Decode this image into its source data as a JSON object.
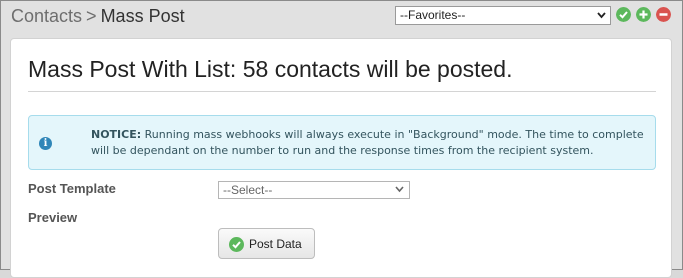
{
  "breadcrumb": {
    "parent": "Contacts",
    "separator": ">",
    "current": "Mass Post"
  },
  "favorites": {
    "selected": "--Favorites--",
    "actions": [
      "check-icon",
      "plus-icon",
      "minus-icon"
    ]
  },
  "main": {
    "title": "Mass Post With List: 58 contacts will be posted.",
    "notice": {
      "label": "NOTICE:",
      "text": " Running mass webhooks will always execute in \"Background\" mode. The time to complete will be dependant on the number to run and the response times from the recipient system.",
      "icon": "info-icon"
    },
    "post_template_label": "Post Template",
    "post_template_selected": "--Select--",
    "preview_label": "Preview",
    "post_button_label": "Post Data"
  },
  "colors": {
    "green": "#5cb85c",
    "red": "#d9534f",
    "info_blue": "#2f86b8",
    "notice_bg": "#e4f6fb"
  }
}
